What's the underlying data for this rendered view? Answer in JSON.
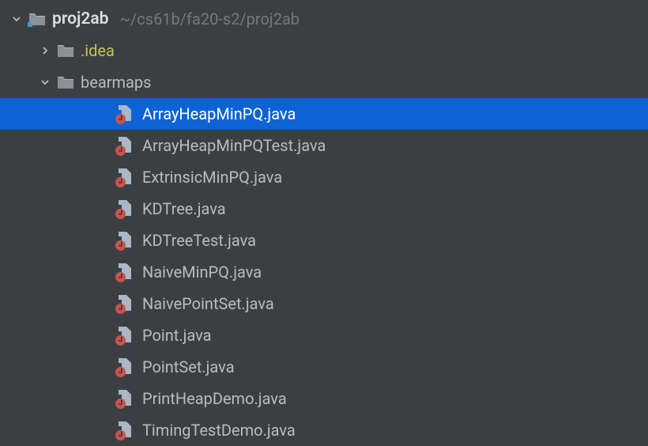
{
  "root": {
    "name": "proj2ab",
    "path": "~/cs61b/fa20-s2/proj2ab"
  },
  "idea_folder": ".idea",
  "bearmaps_folder": "bearmaps",
  "files": [
    {
      "name": "ArrayHeapMinPQ.java",
      "selected": true
    },
    {
      "name": "ArrayHeapMinPQTest.java",
      "selected": false
    },
    {
      "name": "ExtrinsicMinPQ.java",
      "selected": false
    },
    {
      "name": "KDTree.java",
      "selected": false
    },
    {
      "name": "KDTreeTest.java",
      "selected": false
    },
    {
      "name": "NaiveMinPQ.java",
      "selected": false
    },
    {
      "name": "NaivePointSet.java",
      "selected": false
    },
    {
      "name": "Point.java",
      "selected": false
    },
    {
      "name": "PointSet.java",
      "selected": false
    },
    {
      "name": "PrintHeapDemo.java",
      "selected": false
    },
    {
      "name": "TimingTestDemo.java",
      "selected": false
    }
  ]
}
